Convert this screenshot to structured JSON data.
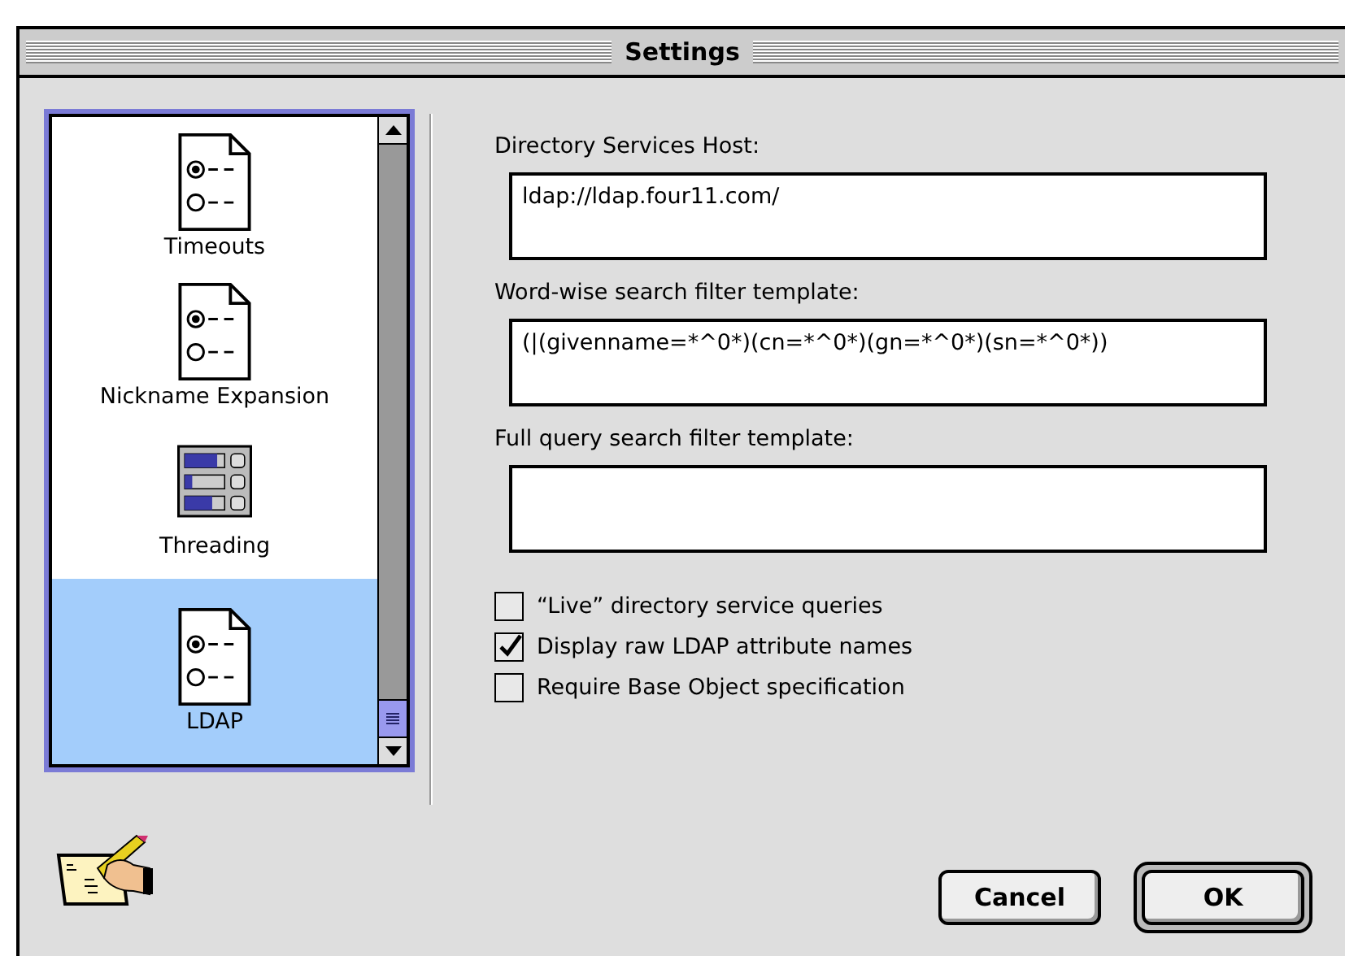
{
  "window": {
    "title": "Settings"
  },
  "sidebar": {
    "items": [
      {
        "label": "Timeouts",
        "kind": "form",
        "selected": false
      },
      {
        "label": "Nickname Expansion",
        "kind": "form",
        "selected": false
      },
      {
        "label": "Threading",
        "kind": "sliders",
        "selected": false
      },
      {
        "label": "LDAP",
        "kind": "form",
        "selected": true
      }
    ]
  },
  "fields": [
    {
      "label": "Directory Services Host:",
      "value": "ldap://ldap.four11.com/"
    },
    {
      "label": "Word-wise search filter template:",
      "value": "(|(givenname=*^0*)(cn=*^0*)(gn=*^0*)(sn=*^0*))"
    },
    {
      "label": "Full query search filter template:"
    }
  ],
  "checkboxes": [
    {
      "label": "“Live” directory service queries",
      "checked": false
    },
    {
      "label": "Display raw LDAP attribute names",
      "checked": true
    },
    {
      "label": "Require Base Object specification",
      "checked": false
    }
  ],
  "buttons": [
    {
      "label": "Cancel",
      "default": false
    },
    {
      "label": "OK",
      "default": true
    }
  ]
}
